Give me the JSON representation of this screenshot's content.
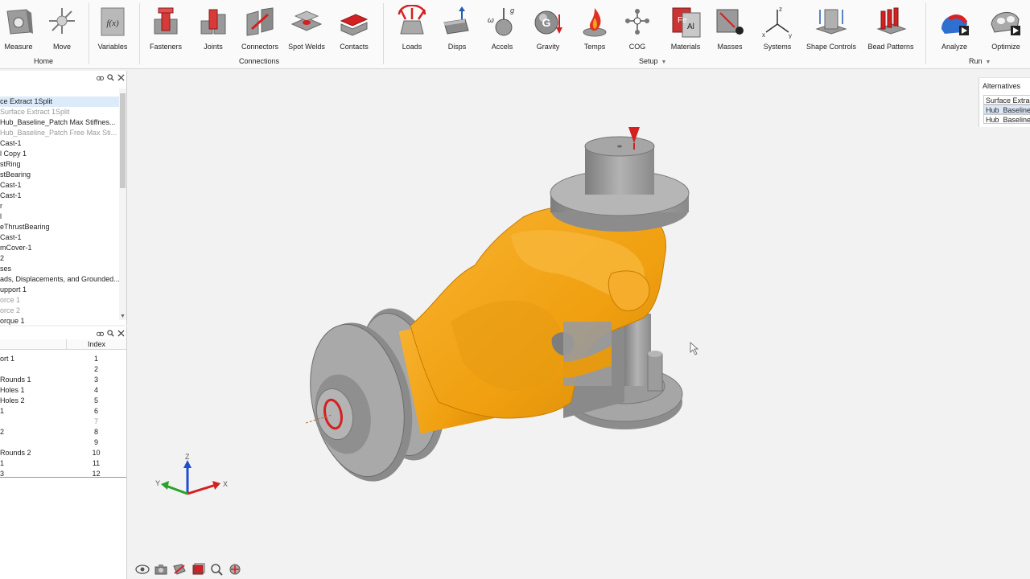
{
  "ribbon": {
    "home": {
      "group_label": "Home",
      "items": [
        {
          "label": "Measure",
          "icon": "measure-icon"
        },
        {
          "label": "Move",
          "icon": "move-icon"
        }
      ]
    },
    "variables": {
      "label": "Variables",
      "icon": "fx-icon",
      "icon_text": "f(x)"
    },
    "connections": {
      "group_label": "Connections",
      "items": [
        {
          "label": "Fasteners"
        },
        {
          "label": "Joints"
        },
        {
          "label": "Connectors"
        },
        {
          "label": "Spot Welds"
        },
        {
          "label": "Contacts"
        }
      ]
    },
    "setup": {
      "group_label": "Setup",
      "items": [
        {
          "label": "Loads"
        },
        {
          "label": "Disps"
        },
        {
          "label": "Accels"
        },
        {
          "label": "Gravity"
        },
        {
          "label": "Temps"
        },
        {
          "label": "COG"
        },
        {
          "label": "Materials"
        },
        {
          "label": "Masses"
        },
        {
          "label": "Systems"
        },
        {
          "label": "Shape Controls"
        },
        {
          "label": "Bead Patterns"
        }
      ]
    },
    "run": {
      "group_label": "Run",
      "items": [
        {
          "label": "Analyze"
        },
        {
          "label": "Optimize"
        }
      ]
    },
    "icon_text": {
      "accels_omega": "ω",
      "accels_g": "g",
      "gravity_g": "G",
      "materials_fe": "Fe",
      "materials_al": "Al",
      "systems_x": "x",
      "systems_y": "y",
      "systems_z": "z"
    }
  },
  "tree": {
    "rows": [
      {
        "text": "ce Extract 1Split",
        "state": "selected"
      },
      {
        "text": "Surface Extract 1Split",
        "state": "dim"
      },
      {
        "text": "Hub_Baseline_Patch Max Stiffnes...",
        "state": "normal"
      },
      {
        "text": "Hub_Baseline_Patch Free Max Sti...",
        "state": "dim"
      },
      {
        "text": "Cast-1",
        "state": "normal"
      },
      {
        "text": "l Copy 1",
        "state": "normal"
      },
      {
        "text": "stRing",
        "state": "normal"
      },
      {
        "text": "stBearing",
        "state": "normal"
      },
      {
        "text": "Cast-1",
        "state": "normal"
      },
      {
        "text": "Cast-1",
        "state": "normal"
      },
      {
        "text": "r",
        "state": "normal"
      },
      {
        "text": "l",
        "state": "normal"
      },
      {
        "text": "eThrustBearing",
        "state": "normal"
      },
      {
        "text": "Cast-1",
        "state": "normal"
      },
      {
        "text": "mCover-1",
        "state": "normal"
      },
      {
        "text": "2",
        "state": "normal"
      },
      {
        "text": "ses",
        "state": "normal"
      },
      {
        "text": "ads, Displacements, and Grounded...",
        "state": "normal"
      },
      {
        "text": "upport 1",
        "state": "normal"
      },
      {
        "text": "orce 1",
        "state": "dim"
      },
      {
        "text": "orce 2",
        "state": "dim"
      },
      {
        "text": "orque 1",
        "state": "normal"
      }
    ]
  },
  "table": {
    "index_header": "Index",
    "rows": [
      {
        "name": "ort 1",
        "index": "1",
        "dim": false
      },
      {
        "name": "",
        "index": "2",
        "dim": false
      },
      {
        "name": "Rounds 1",
        "index": "3",
        "dim": false
      },
      {
        "name": "Holes 1",
        "index": "4",
        "dim": false
      },
      {
        "name": "Holes 2",
        "index": "5",
        "dim": false
      },
      {
        "name": "1",
        "index": "6",
        "dim": false
      },
      {
        "name": "",
        "index": "7",
        "dim": true
      },
      {
        "name": "2",
        "index": "8",
        "dim": false
      },
      {
        "name": "",
        "index": "9",
        "dim": false
      },
      {
        "name": "Rounds 2",
        "index": "10",
        "dim": false
      },
      {
        "name": "1",
        "index": "11",
        "dim": false
      },
      {
        "name": "3",
        "index": "12",
        "dim": false
      }
    ]
  },
  "alternatives": {
    "title": "Alternatives",
    "items": [
      {
        "label": "Surface Extract"
      },
      {
        "label": "Hub_Baseline"
      },
      {
        "label": "Hub_Baseline"
      }
    ],
    "selected_index": 1
  },
  "triad": {
    "z": "Z",
    "y": "Y",
    "x": "X"
  },
  "colors": {
    "part_orange": "#f2a41e",
    "part_gray": "#9a9a9a",
    "load_red": "#d42020",
    "accent_blue": "#1f5fb3"
  }
}
